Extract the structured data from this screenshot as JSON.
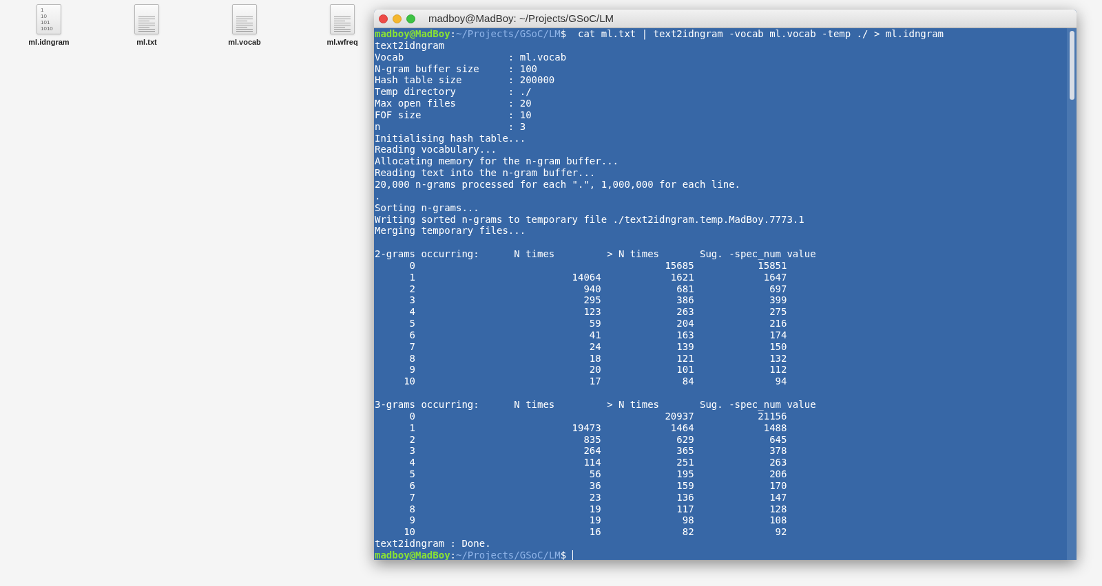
{
  "desktop_icons": [
    {
      "label": "ml.idngram",
      "kind": "binary",
      "glyph_lines": [
        "1",
        "10",
        "101",
        "1010"
      ]
    },
    {
      "label": "ml.txt",
      "kind": "text"
    },
    {
      "label": "ml.vocab",
      "kind": "text"
    },
    {
      "label": "ml.wfreq",
      "kind": "text"
    }
  ],
  "terminal": {
    "title": "madboy@MadBoy: ~/Projects/GSoC/LM",
    "lines": [
      {
        "kind": "prompt",
        "user": "madboy@MadBoy",
        "sep": ":",
        "path": "~/Projects/GSoC/LM",
        "symbol": "$",
        "command": "cat ml.txt | text2idngram -vocab ml.vocab -temp ./ > ml.idngram",
        "cursor": false
      },
      {
        "kind": "text",
        "text": "text2idngram"
      },
      {
        "kind": "setting",
        "key": "Vocab",
        "value": ": ml.vocab"
      },
      {
        "kind": "setting",
        "key": "N-gram buffer size",
        "value": ": 100"
      },
      {
        "kind": "setting",
        "key": "Hash table size",
        "value": ": 200000"
      },
      {
        "kind": "setting",
        "key": "Temp directory",
        "value": ": ./"
      },
      {
        "kind": "setting",
        "key": "Max open files",
        "value": ": 20"
      },
      {
        "kind": "setting",
        "key": "FOF size",
        "value": ": 10"
      },
      {
        "kind": "setting",
        "key": "n",
        "value": ": 3"
      },
      {
        "kind": "text",
        "text": "Initialising hash table..."
      },
      {
        "kind": "text",
        "text": "Reading vocabulary..."
      },
      {
        "kind": "text",
        "text": "Allocating memory for the n-gram buffer..."
      },
      {
        "kind": "text",
        "text": "Reading text into the n-gram buffer..."
      },
      {
        "kind": "text",
        "text": "20,000 n-grams processed for each \".\", 1,000,000 for each line."
      },
      {
        "kind": "text",
        "text": "."
      },
      {
        "kind": "text",
        "text": "Sorting n-grams..."
      },
      {
        "kind": "text",
        "text": "Writing sorted n-grams to temporary file ./text2idngram.temp.MadBoy.7773.1"
      },
      {
        "kind": "text",
        "text": "Merging temporary files..."
      },
      {
        "kind": "blank"
      },
      {
        "kind": "table",
        "columns": [
          "2-grams occurring:",
          "N times",
          "> N times",
          "Sug. -spec_num value"
        ],
        "rows": [
          [
            "0",
            null,
            "15685",
            "15851"
          ],
          [
            "1",
            "14064",
            "1621",
            "1647"
          ],
          [
            "2",
            "940",
            "681",
            "697"
          ],
          [
            "3",
            "295",
            "386",
            "399"
          ],
          [
            "4",
            "123",
            "263",
            "275"
          ],
          [
            "5",
            "59",
            "204",
            "216"
          ],
          [
            "6",
            "41",
            "163",
            "174"
          ],
          [
            "7",
            "24",
            "139",
            "150"
          ],
          [
            "8",
            "18",
            "121",
            "132"
          ],
          [
            "9",
            "20",
            "101",
            "112"
          ],
          [
            "10",
            "17",
            "84",
            "94"
          ]
        ]
      },
      {
        "kind": "blank"
      },
      {
        "kind": "table",
        "columns": [
          "3-grams occurring:",
          "N times",
          "> N times",
          "Sug. -spec_num value"
        ],
        "rows": [
          [
            "0",
            null,
            "20937",
            "21156"
          ],
          [
            "1",
            "19473",
            "1464",
            "1488"
          ],
          [
            "2",
            "835",
            "629",
            "645"
          ],
          [
            "3",
            "264",
            "365",
            "378"
          ],
          [
            "4",
            "114",
            "251",
            "263"
          ],
          [
            "5",
            "56",
            "195",
            "206"
          ],
          [
            "6",
            "36",
            "159",
            "170"
          ],
          [
            "7",
            "23",
            "136",
            "147"
          ],
          [
            "8",
            "19",
            "117",
            "128"
          ],
          [
            "9",
            "19",
            "98",
            "108"
          ],
          [
            "10",
            "16",
            "82",
            "92"
          ]
        ]
      },
      {
        "kind": "text",
        "text": "text2idngram : Done."
      },
      {
        "kind": "prompt",
        "user": "madboy@MadBoy",
        "sep": ":",
        "path": "~/Projects/GSoC/LM",
        "symbol": "$",
        "cursor": true
      }
    ]
  }
}
